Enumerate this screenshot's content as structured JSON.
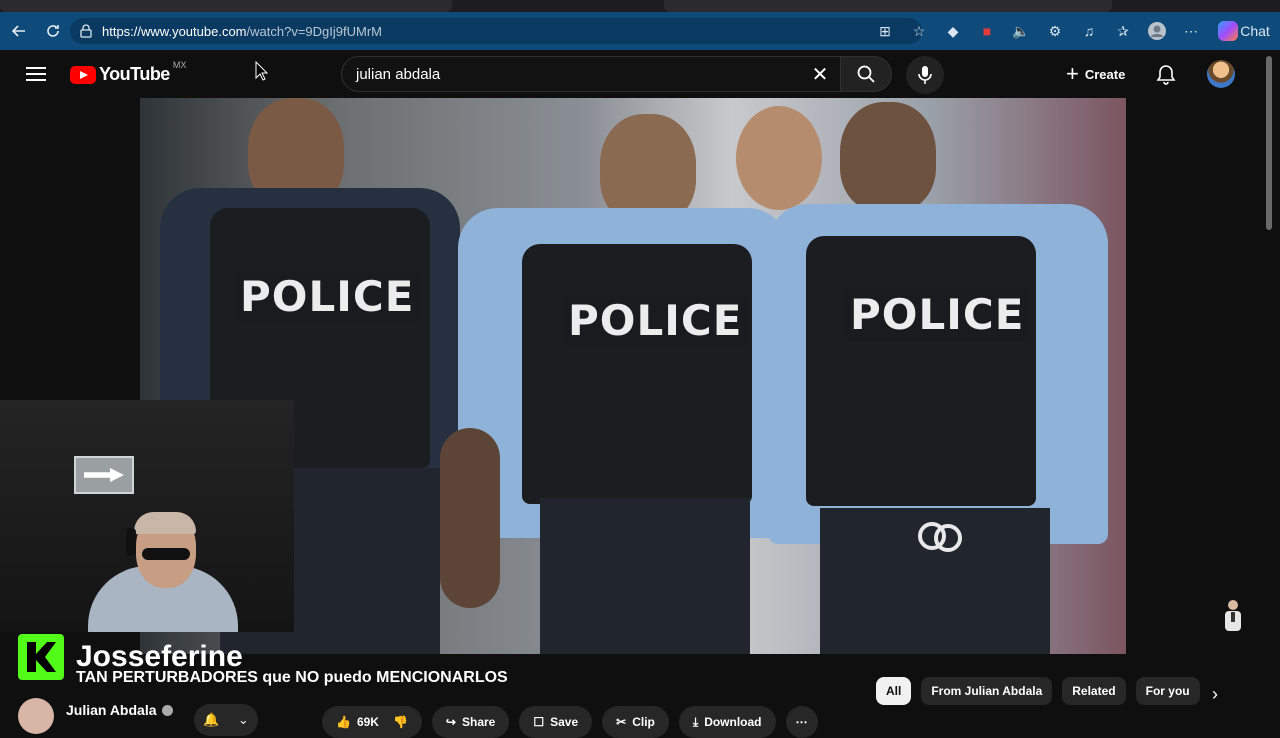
{
  "browser": {
    "url_host": "https://www.youtube.com",
    "url_path": "/watch?v=9DgIj9fUMrM",
    "copilot_label": "Chat"
  },
  "header": {
    "logo_text": "YouTube",
    "region": "MX",
    "search_value": "julian abdala",
    "create_label": "Create"
  },
  "player": {
    "vest_labels": [
      "POLICE",
      "POLICE",
      "POLICE"
    ]
  },
  "overlay": {
    "streamer_name": "Josseferine"
  },
  "video": {
    "title": "TAN PERTURBADORES que NO puedo MENCIONARLOS",
    "channel_name": "Julian Abdala",
    "actions": {
      "like_count": "69K",
      "share": "Share",
      "save": "Save",
      "clip": "Clip",
      "download": "Download"
    }
  },
  "sidebar_chips": [
    "All",
    "From Julian Abdala",
    "Related",
    "For you"
  ]
}
